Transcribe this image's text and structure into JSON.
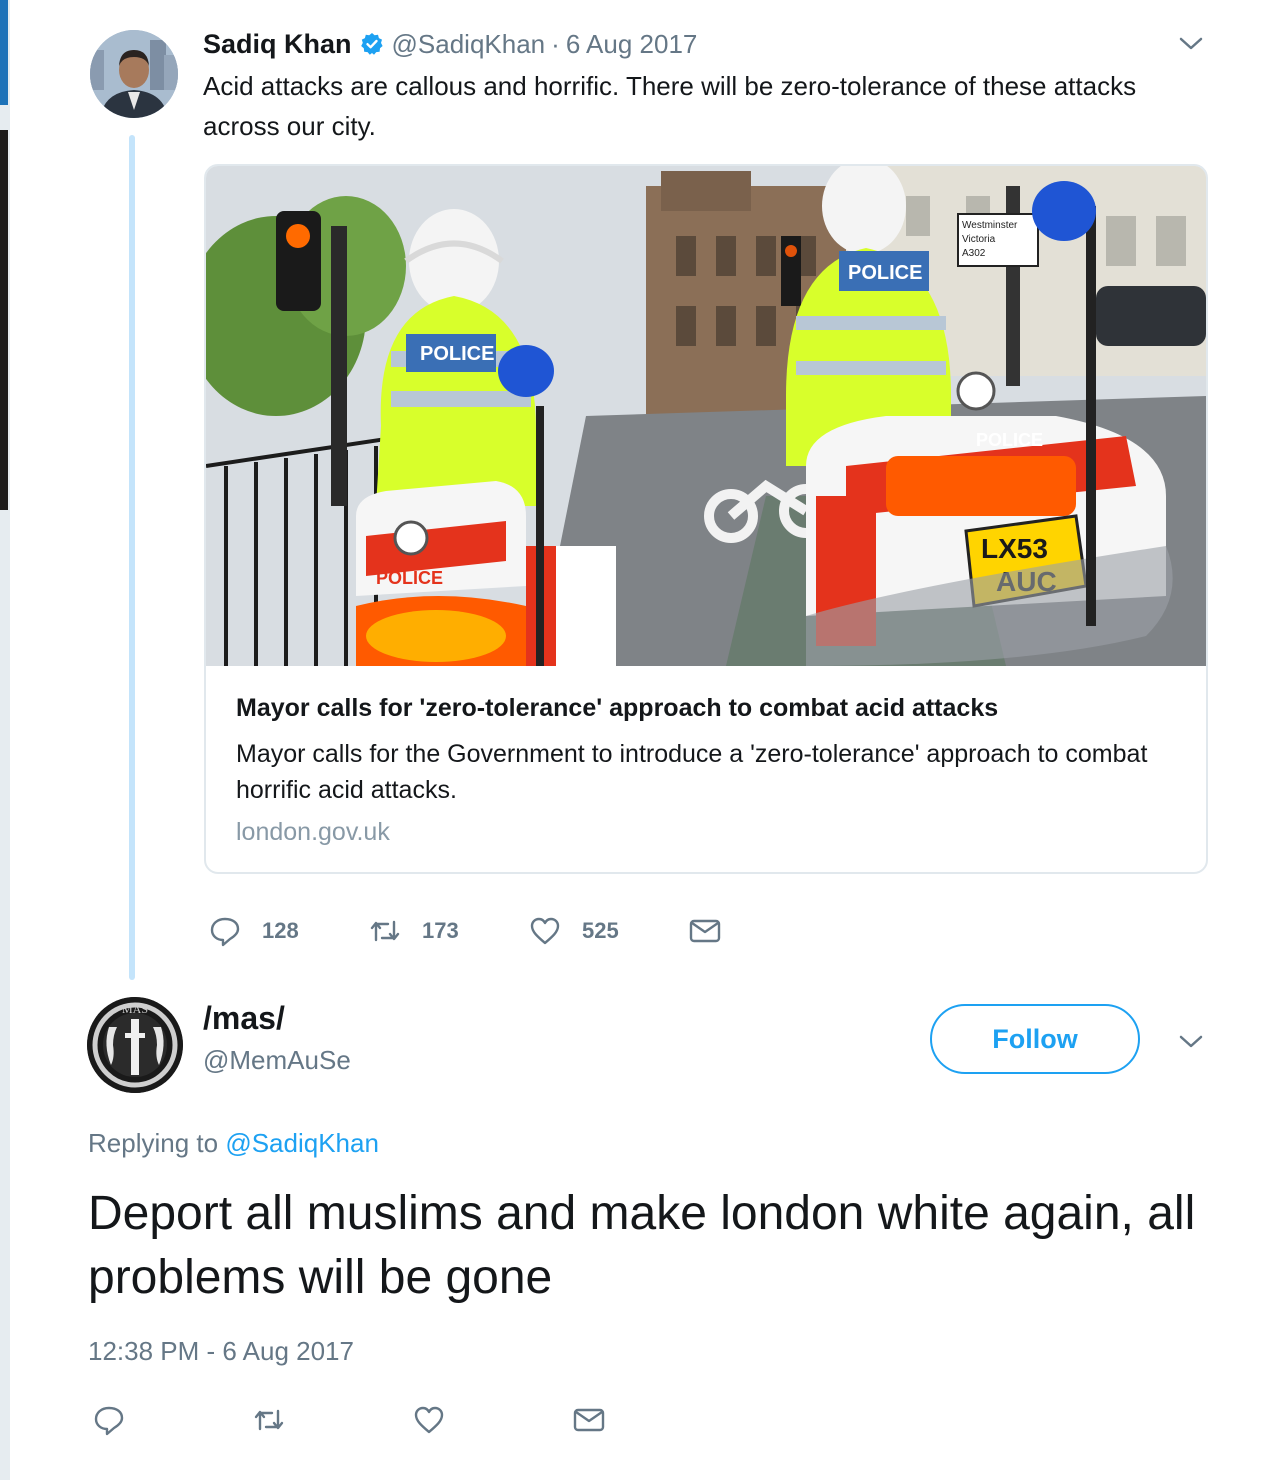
{
  "tweet1": {
    "name": "Sadiq Khan",
    "handle": "@SadiqKhan",
    "separator": "·",
    "date": "6 Aug 2017",
    "text": "Acid attacks are callous and horrific. There will be zero-tolerance of these attacks across our city.",
    "card": {
      "image_text": {
        "police_left": "POLICE",
        "police_right": "POLICE",
        "police_bike_left": "POLICE",
        "police_bike_right": "POLICE",
        "plate_line1": "LX53",
        "plate_line2": "AUC",
        "sign_line1": "Westminster",
        "sign_line2": "Victoria",
        "sign_line3": "A302"
      },
      "title": "Mayor calls for 'zero-tolerance' approach to combat acid attacks",
      "description": "Mayor calls for the Government to introduce a 'zero-tolerance' approach to combat horrific acid attacks.",
      "domain": "london.gov.uk"
    },
    "actions": {
      "replies": "128",
      "retweets": "173",
      "likes": "525"
    }
  },
  "tweet2": {
    "name": "/mas/",
    "handle": "@MemAuSe",
    "avatar_text": "MAS",
    "follow_label": "Follow",
    "replying_prefix": "Replying to",
    "replying_mention": "@SadiqKhan",
    "text": "Deport all muslims and make london white again, all problems will be gone",
    "timestamp": "12:38 PM - 6 Aug 2017"
  },
  "colors": {
    "accent": "#1da1f2",
    "secondary_text": "#657786",
    "thread_line": "#c4e4fb",
    "card_border": "#e1e8ed"
  },
  "icons": {
    "verified": "verified-badge-icon",
    "reply": "reply-icon",
    "retweet": "retweet-icon",
    "like": "heart-icon",
    "message": "envelope-icon",
    "caret": "chevron-down-icon"
  }
}
